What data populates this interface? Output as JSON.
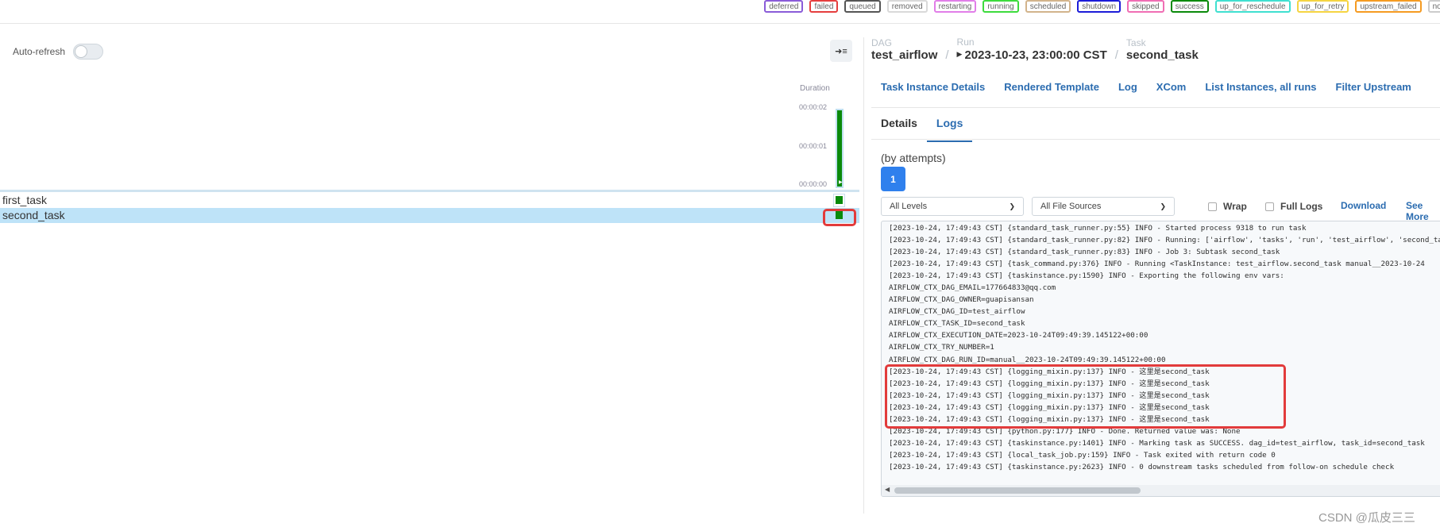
{
  "legend": [
    {
      "label": "deferred",
      "color": "#8a5cd8"
    },
    {
      "label": "failed",
      "color": "#e53e3e"
    },
    {
      "label": "queued",
      "color": "#555555"
    },
    {
      "label": "removed",
      "color": "#d9d9d9"
    },
    {
      "label": "restarting",
      "color": "#e17ee8"
    },
    {
      "label": "running",
      "color": "#3ddb3d"
    },
    {
      "label": "scheduled",
      "color": "#d2b48c"
    },
    {
      "label": "shutdown",
      "color": "#1c1cd8"
    },
    {
      "label": "skipped",
      "color": "#f06eb4"
    },
    {
      "label": "success",
      "color": "#0a8a0a"
    },
    {
      "label": "up_for_reschedule",
      "color": "#40e0d0"
    },
    {
      "label": "up_for_retry",
      "color": "#f5d442"
    },
    {
      "label": "upstream_failed",
      "color": "#f59b22"
    },
    {
      "label": "no_status",
      "color": "#cccccc"
    }
  ],
  "left": {
    "auto_refresh_label": "Auto-refresh",
    "duration_title": "Duration",
    "ticks": [
      "00:00:02",
      "00:00:01",
      "00:00:00"
    ],
    "tasks": [
      {
        "name": "first_task",
        "selected": false
      },
      {
        "name": "second_task",
        "selected": true
      }
    ]
  },
  "breadcrumb": {
    "dag_key": "DAG",
    "dag_value": "test_airflow",
    "run_key": "Run",
    "run_value": "2023-10-23, 23:00:00 CST",
    "task_key": "Task",
    "task_value": "second_task"
  },
  "ti_nav": [
    "Task Instance Details",
    "Rendered Template",
    "Log",
    "XCom",
    "List Instances, all runs",
    "Filter Upstream"
  ],
  "tabs": {
    "details": "Details",
    "logs": "Logs"
  },
  "attempts": {
    "label": "(by attempts)",
    "current": "1"
  },
  "log_controls": {
    "levels": "All Levels",
    "sources": "All File Sources",
    "wrap": "Wrap",
    "full_logs": "Full Logs",
    "download": "Download",
    "see_more": "See More"
  },
  "log_lines": [
    "[2023-10-24, 17:49:43 CST] {standard_task_runner.py:55} INFO - Started process 9318 to run task",
    "[2023-10-24, 17:49:43 CST] {standard_task_runner.py:82} INFO - Running: ['airflow', 'tasks', 'run', 'test_airflow', 'second_task'",
    "[2023-10-24, 17:49:43 CST] {standard_task_runner.py:83} INFO - Job 3: Subtask second_task",
    "[2023-10-24, 17:49:43 CST] {task_command.py:376} INFO - Running <TaskInstance: test_airflow.second_task manual__2023-10-24",
    "[2023-10-24, 17:49:43 CST] {taskinstance.py:1590} INFO - Exporting the following env vars:",
    "AIRFLOW_CTX_DAG_EMAIL=177664833@qq.com",
    "AIRFLOW_CTX_DAG_OWNER=guapisansan",
    "AIRFLOW_CTX_DAG_ID=test_airflow",
    "AIRFLOW_CTX_TASK_ID=second_task",
    "AIRFLOW_CTX_EXECUTION_DATE=2023-10-24T09:49:39.145122+00:00",
    "AIRFLOW_CTX_TRY_NUMBER=1",
    "AIRFLOW_CTX_DAG_RUN_ID=manual__2023-10-24T09:49:39.145122+00:00",
    "[2023-10-24, 17:49:43 CST] {logging_mixin.py:137} INFO - 这里是second_task",
    "[2023-10-24, 17:49:43 CST] {logging_mixin.py:137} INFO - 这里是second_task",
    "[2023-10-24, 17:49:43 CST] {logging_mixin.py:137} INFO - 这里是second_task",
    "[2023-10-24, 17:49:43 CST] {logging_mixin.py:137} INFO - 这里是second_task",
    "[2023-10-24, 17:49:43 CST] {logging_mixin.py:137} INFO - 这里是second_task",
    "[2023-10-24, 17:49:43 CST] {python.py:177} INFO - Done. Returned value was: None",
    "[2023-10-24, 17:49:43 CST] {taskinstance.py:1401} INFO - Marking task as SUCCESS. dag_id=test_airflow, task_id=second_task",
    "[2023-10-24, 17:49:43 CST] {local_task_job.py:159} INFO - Task exited with return code 0",
    "[2023-10-24, 17:49:43 CST] {taskinstance.py:2623} INFO - 0 downstream tasks scheduled from follow-on schedule check"
  ],
  "watermark": "CSDN @瓜皮三三"
}
